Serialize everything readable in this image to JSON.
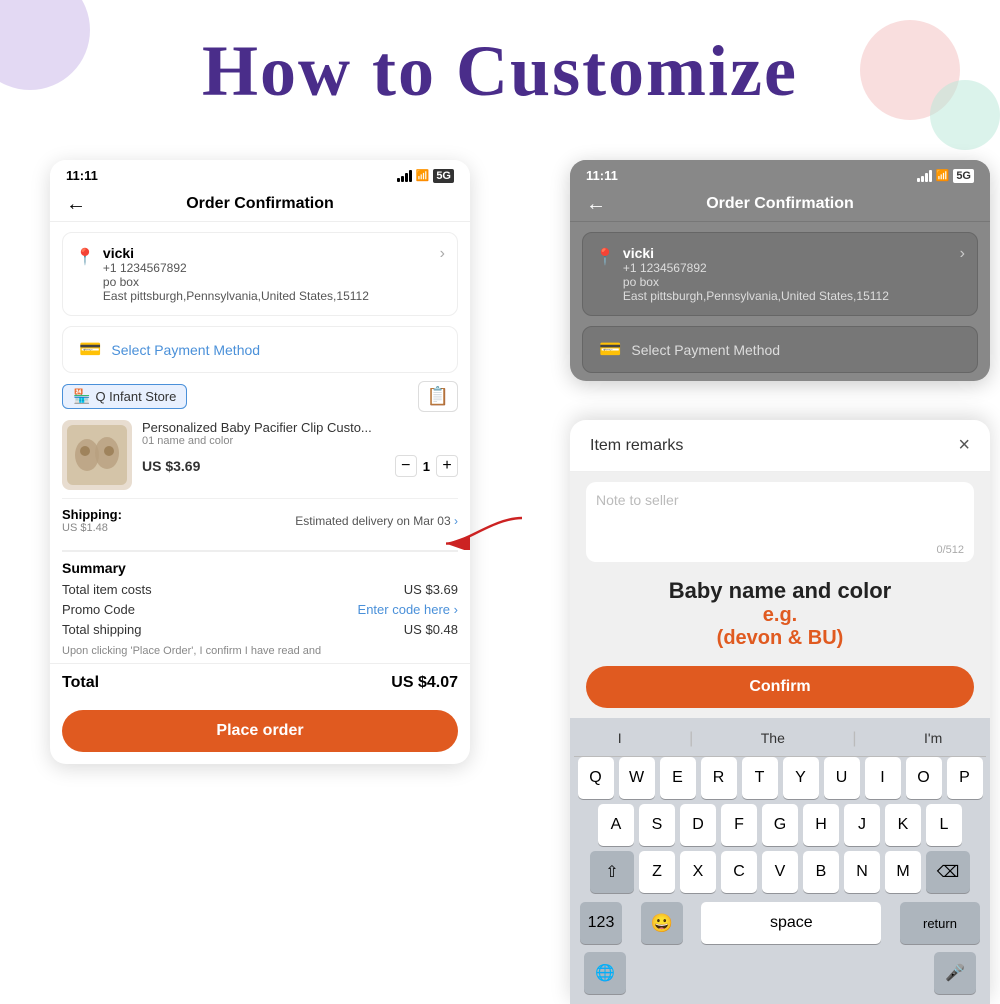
{
  "page": {
    "title": "How to Customize",
    "background_color": "#ffffff"
  },
  "left_phone": {
    "status_time": "11:11",
    "header_title": "Order Confirmation",
    "address": {
      "name": "vicki",
      "phone": "+1 1234567892",
      "line1": "po box",
      "line2": "East pittsburgh,Pennsylvania,United States,15112"
    },
    "payment": {
      "label": "Select Payment Method"
    },
    "store": {
      "name": "Q Infant Store"
    },
    "product": {
      "name": "Personalized Baby Pacifier Clip Custo...",
      "variant": "01 name and color",
      "price": "US $3.69",
      "quantity": "1"
    },
    "shipping": {
      "label": "Shipping:",
      "cost": "US $1.48",
      "delivery": "Estimated delivery on Mar 03"
    },
    "summary": {
      "title": "Summary",
      "total_items_label": "Total item costs",
      "total_items_value": "US $3.69",
      "promo_label": "Promo Code",
      "promo_value": "Enter code here",
      "total_shipping_label": "Total shipping",
      "total_shipping_value": "US $0.48",
      "disclaimer": "Upon clicking 'Place Order', I confirm I have read and",
      "total_label": "Total",
      "total_value": "US $4.07"
    },
    "place_order_btn": "Place order"
  },
  "right_phone": {
    "status_time": "11:11",
    "header_title": "Order Confirmation",
    "address": {
      "name": "vicki",
      "phone": "+1 1234567892",
      "line1": "po box",
      "line2": "East pittsburgh,Pennsylvania,United States,15112"
    },
    "payment": {
      "label": "Select Payment Method"
    }
  },
  "item_remarks_popup": {
    "title": "Item remarks",
    "close_label": "×",
    "placeholder": "Note to seller",
    "counter": "0/512",
    "hint_title": "Baby name and color",
    "hint_example": "e.g.\n(devon & BU)",
    "confirm_btn": "Confirm"
  },
  "keyboard": {
    "suggestions": [
      "I",
      "The",
      "I'm"
    ],
    "row1": [
      "Q",
      "W",
      "E",
      "R",
      "T",
      "Y",
      "U",
      "I",
      "O",
      "P"
    ],
    "row2": [
      "A",
      "S",
      "D",
      "F",
      "G",
      "H",
      "J",
      "K",
      "L"
    ],
    "row3": [
      "Z",
      "X",
      "C",
      "V",
      "B",
      "N",
      "M"
    ],
    "bottom": {
      "num_label": "123",
      "space_label": "space",
      "return_label": "return"
    }
  }
}
